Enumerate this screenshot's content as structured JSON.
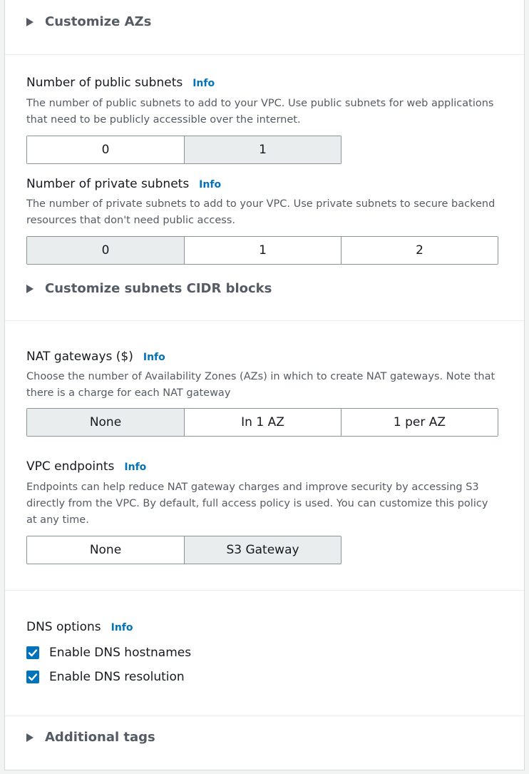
{
  "customize_azs": {
    "label": "Customize AZs"
  },
  "public_subnets": {
    "label": "Number of public subnets",
    "info": "Info",
    "description": "The number of public subnets to add to your VPC. Use public subnets for web applications that need to be publicly accessible over the internet.",
    "options": [
      "0",
      "1"
    ],
    "selected": "1"
  },
  "private_subnets": {
    "label": "Number of private subnets",
    "info": "Info",
    "description": "The number of private subnets to add to your VPC. Use private subnets to secure backend resources that don't need public access.",
    "options": [
      "0",
      "1",
      "2"
    ],
    "selected": "0"
  },
  "customize_cidr": {
    "label": "Customize subnets CIDR blocks"
  },
  "nat_gateways": {
    "label": "NAT gateways ($)",
    "info": "Info",
    "description": "Choose the number of Availability Zones (AZs) in which to create NAT gateways. Note that there is a charge for each NAT gateway",
    "options": [
      "None",
      "In 1 AZ",
      "1 per AZ"
    ],
    "selected": "None"
  },
  "vpc_endpoints": {
    "label": "VPC endpoints",
    "info": "Info",
    "description": "Endpoints can help reduce NAT gateway charges and improve security by accessing S3 directly from the VPC. By default, full access policy is used. You can customize this policy at any time.",
    "options": [
      "None",
      "S3 Gateway"
    ],
    "selected": "S3 Gateway"
  },
  "dns_options": {
    "label": "DNS options",
    "info": "Info",
    "hostnames": {
      "label": "Enable DNS hostnames",
      "checked": true
    },
    "resolution": {
      "label": "Enable DNS resolution",
      "checked": true
    }
  },
  "additional_tags": {
    "label": "Additional tags"
  },
  "colors": {
    "link": "#0073bb",
    "selected_bg": "#eaeded",
    "checkbox": "#0073bb"
  }
}
